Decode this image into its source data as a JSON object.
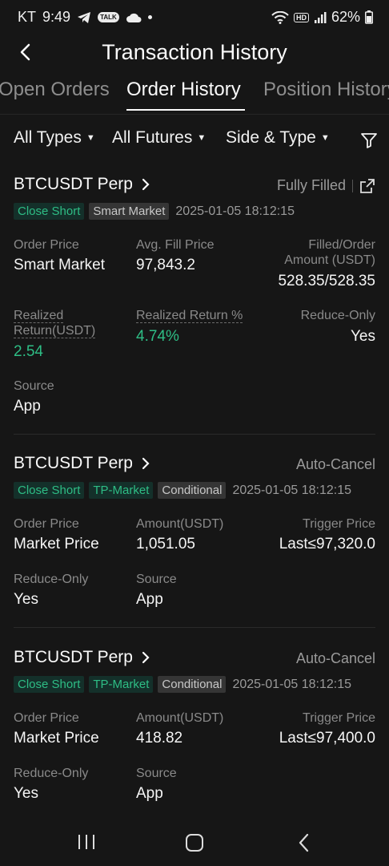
{
  "status_bar": {
    "carrier": "KT",
    "time": "9:49",
    "talk_badge": "TALK",
    "hd_badge": "HD",
    "battery": "62%"
  },
  "header": {
    "title": "Transaction History"
  },
  "tabs": [
    {
      "label": "Open Orders"
    },
    {
      "label": "Order History"
    },
    {
      "label": "Position History"
    }
  ],
  "filters": {
    "types": "All Types",
    "futures": "All Futures",
    "side_type": "Side & Type"
  },
  "orders": [
    {
      "symbol": "BTCUSDT Perp",
      "status": "Fully Filled",
      "tags": [
        "Close Short",
        "Smart Market"
      ],
      "time": "2025-01-05 18:12:15",
      "fields": {
        "order_price_label": "Order Price",
        "order_price": "Smart Market",
        "avg_fill_label": "Avg. Fill Price",
        "avg_fill": "97,843.2",
        "filled_label": "Filled/Order Amount (USDT)",
        "filled": "528.35/528.35",
        "realized_label": "Realized Return(USDT)",
        "realized": "2.54",
        "realized_pct_label": "Realized Return %",
        "realized_pct": "4.74%",
        "reduce_label": "Reduce-Only",
        "reduce": "Yes",
        "source_label": "Source",
        "source": "App"
      }
    },
    {
      "symbol": "BTCUSDT Perp",
      "status": "Auto-Cancel",
      "tags": [
        "Close Short",
        "TP-Market",
        "Conditional"
      ],
      "time": "2025-01-05 18:12:15",
      "fields": {
        "order_price_label": "Order Price",
        "order_price": "Market Price",
        "amount_label": "Amount(USDT)",
        "amount": "1,051.05",
        "trigger_label": "Trigger Price",
        "trigger": "Last≤97,320.0",
        "reduce_label": "Reduce-Only",
        "reduce": "Yes",
        "source_label": "Source",
        "source": "App"
      }
    },
    {
      "symbol": "BTCUSDT Perp",
      "status": "Auto-Cancel",
      "tags": [
        "Close Short",
        "TP-Market",
        "Conditional"
      ],
      "time": "2025-01-05 18:12:15",
      "fields": {
        "order_price_label": "Order Price",
        "order_price": "Market Price",
        "amount_label": "Amount(USDT)",
        "amount": "418.82",
        "trigger_label": "Trigger Price",
        "trigger": "Last≤97,400.0",
        "reduce_label": "Reduce-Only",
        "reduce": "Yes",
        "source_label": "Source",
        "source": "App"
      }
    }
  ],
  "colors": {
    "background": "#161616",
    "positive": "#2ebd85",
    "muted": "#8a8a8a",
    "tag_gray": "#353535"
  },
  "icons": [
    "telegram-icon",
    "talk-icon",
    "cloud-icon",
    "wifi-icon",
    "hd-icon",
    "signal-icon",
    "battery-icon",
    "back-icon",
    "filter-icon",
    "chevron-right-icon",
    "share-icon",
    "recent-apps-icon",
    "home-icon",
    "nav-back-icon"
  ]
}
